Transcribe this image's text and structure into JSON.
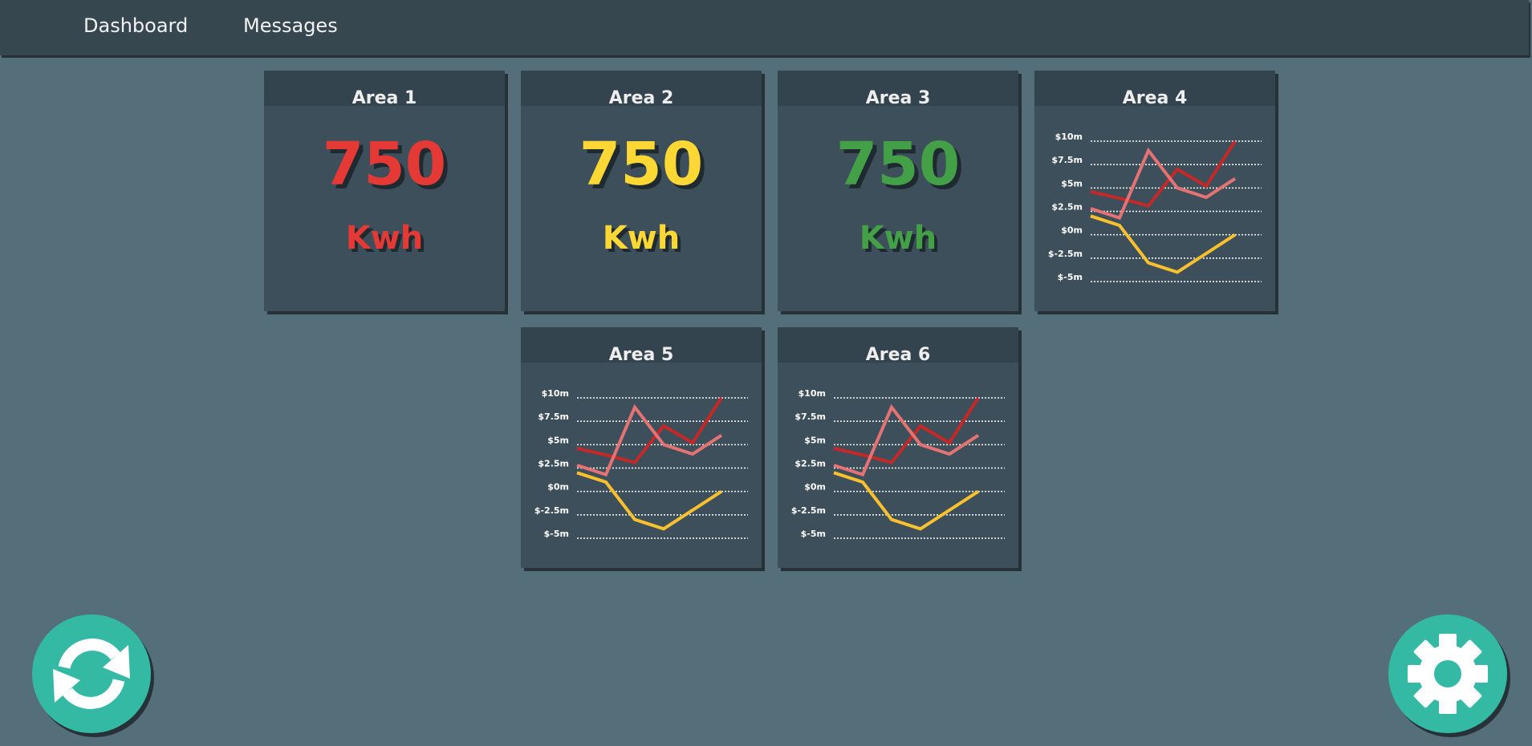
{
  "nav": {
    "items": [
      {
        "label": "Dashboard"
      },
      {
        "label": "Messages"
      }
    ]
  },
  "colors": {
    "background": "#546e7a",
    "topbar": "#37474f",
    "card": "#3d4f5a",
    "red": "#e53935",
    "yellow": "#fdd835",
    "green": "#43a047",
    "fab": "#34b9a5"
  },
  "cards": [
    {
      "title": "Area 1",
      "value": "750",
      "unit": "Kwh",
      "color": "#e53935"
    },
    {
      "title": "Area 2",
      "value": "750",
      "unit": "Kwh",
      "color": "#fdd835"
    },
    {
      "title": "Area 3",
      "value": "750",
      "unit": "Kwh",
      "color": "#43a047"
    }
  ],
  "chart_cards": [
    {
      "title": "Area 4"
    },
    {
      "title": "Area 5"
    },
    {
      "title": "Area 6"
    }
  ],
  "chart_data": {
    "type": "line",
    "y_tick_labels": [
      "$10m",
      "$7.5m",
      "$5m",
      "$2.5m",
      "$0m",
      "$-2.5m",
      "$-5m"
    ],
    "ylim": [
      -5,
      10
    ],
    "x": [
      0,
      1,
      2,
      3,
      4,
      5
    ],
    "grid": true,
    "series": [
      {
        "color": "#c62828",
        "values": [
          4.6,
          3.9,
          3.1,
          7.0,
          5.2,
          10.0
        ]
      },
      {
        "color": "#e57373",
        "values": [
          2.8,
          1.8,
          9.0,
          5.0,
          4.0,
          6.0
        ]
      },
      {
        "color": "#fbc02d",
        "values": [
          2.0,
          1.0,
          -3.0,
          -4.0,
          -2.0,
          0.0
        ]
      }
    ]
  },
  "buttons": {
    "refresh_icon": "refresh-icon",
    "settings_icon": "gear-icon"
  }
}
